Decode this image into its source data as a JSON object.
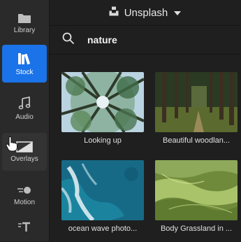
{
  "sidebar": {
    "items": [
      {
        "label": "Library",
        "icon": "folder-icon"
      },
      {
        "label": "Stock",
        "icon": "books-icon"
      },
      {
        "label": "Audio",
        "icon": "music-note-icon"
      },
      {
        "label": "Overlays",
        "icon": "overlay-icon"
      },
      {
        "label": "Motion",
        "icon": "motion-icon"
      },
      {
        "label": "",
        "icon": "text-icon"
      }
    ]
  },
  "header": {
    "source": "Unsplash"
  },
  "search": {
    "value": "nature",
    "placeholder": ""
  },
  "results": [
    {
      "caption": "Looking up"
    },
    {
      "caption": "Beautiful woodlan..."
    },
    {
      "caption": "ocean wave photo..."
    },
    {
      "caption": "Body Grassland in ..."
    }
  ],
  "colors": {
    "accent": "#1a73e8",
    "sidebar": "#2a2a2a",
    "background": "#1f1f1f"
  }
}
